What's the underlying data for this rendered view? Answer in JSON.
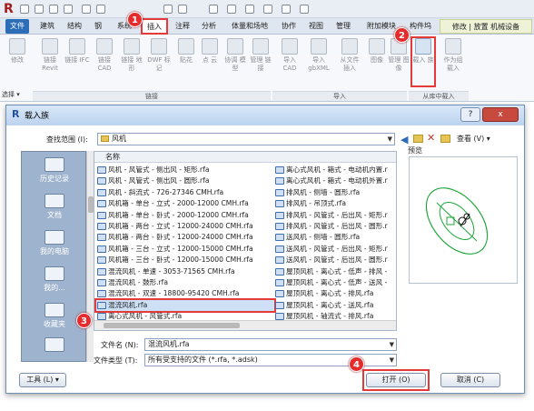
{
  "app": {
    "logo_letter": "R"
  },
  "ribbon_tabs": [
    "文件",
    "建筑",
    "结构",
    "钢",
    "系统",
    "插入",
    "注释",
    "分析",
    "体量和场地",
    "协作",
    "视图",
    "管理",
    "附加模块",
    "构件坞",
    "修改 | 放置 机械设备"
  ],
  "ribbon": {
    "buttons": [
      {
        "label": "修改"
      },
      {
        "label": "链接 Revit"
      },
      {
        "label": "链接 IFC"
      },
      {
        "label": "链接 CAD"
      },
      {
        "label": "链接 地形"
      },
      {
        "label": "DWF 标记"
      },
      {
        "label": "贴花"
      },
      {
        "label": "点 云"
      },
      {
        "label": "协调 模型"
      },
      {
        "label": "管理 链接"
      },
      {
        "label": "导入 CAD"
      },
      {
        "label": "导入 gbXML"
      },
      {
        "label": "从文件 插入"
      },
      {
        "label": "图像"
      },
      {
        "label": "管理 图像"
      },
      {
        "label": "载入 族"
      },
      {
        "label": "作为组 载入"
      }
    ],
    "groups": {
      "select": "选择 ▾",
      "link": "链接",
      "import": "导入",
      "load_from_library": "从库中载入"
    }
  },
  "badges": [
    "1",
    "2",
    "3",
    "4"
  ],
  "dialog": {
    "title": "载入族",
    "help_btn": "?",
    "close_btn": "x",
    "look_in_label": "查找范围 (I):",
    "look_in_value": "风机",
    "view_label": "查看 (V)",
    "preview_label": "预览",
    "places": [
      "历史记录",
      "文档",
      "我的电脑",
      "我的...",
      "收藏夹",
      ""
    ],
    "list_header": "名称",
    "files_col1": [
      "风机 - 风管式 - 侧出风 - 矩形.rfa",
      "风机 - 风管式 - 侧出风 - 圆形.rfa",
      "风机 - 斜流式 - 726-27346 CMH.rfa",
      "风机箱 - 单台 - 立式 - 2000-12000 CMH.rfa",
      "风机箱 - 单台 - 卧式 - 2000-12000 CMH.rfa",
      "风机箱 - 两台 - 立式 - 12000-24000 CMH.rfa",
      "风机箱 - 两台 - 卧式 - 12000-24000 CMH.rfa",
      "风机箱 - 三台 - 立式 - 12000-15000 CMH.rfa",
      "风机箱 - 三台 - 卧式 - 12000-15000 CMH.rfa",
      "混流风机 - 单速 - 3053-71565 CMH.rfa",
      "混流风机 - 鼓形.rfa",
      "混流风机 - 双速 - 18800-95420 CMH.rfa",
      "混流风机.rfa",
      "离心式风机 - 风管式.rfa"
    ],
    "files_col2": [
      "离心式风机 - 箱式 - 电动机内置.r",
      "离心式风机 - 箱式 - 电动机外置.r",
      "排风机 - 侧墙 - 圆形.rfa",
      "排风机 - 吊顶式.rfa",
      "排风机 - 风管式 - 后出风 - 矩形.r",
      "排风机 - 风管式 - 后出风 - 圆形.r",
      "送风机 - 侧墙 - 圆形.rfa",
      "送风机 - 风管式 - 后出风 - 矩形.r",
      "送风机 - 风管式 - 后出风 - 圆形.r",
      "屋顶风机 - 离心式 - 低声 - 排风 -",
      "屋顶风机 - 离心式 - 低声 - 送风 -",
      "屋顶风机 - 离心式 - 排风.rfa",
      "屋顶风机 - 离心式 - 送风.rfa",
      "屋顶风机 - 轴流式 - 排风.rfa"
    ],
    "filename_label": "文件名 (N):",
    "filename_value": "混流风机.rfa",
    "filetype_label": "文件类型 (T):",
    "filetype_value": "所有受支持的文件 (*.rfa, *.adsk)",
    "tools_btn": "工具 (L)",
    "open_btn": "打开 (O)",
    "cancel_btn": "取消 (C)"
  }
}
